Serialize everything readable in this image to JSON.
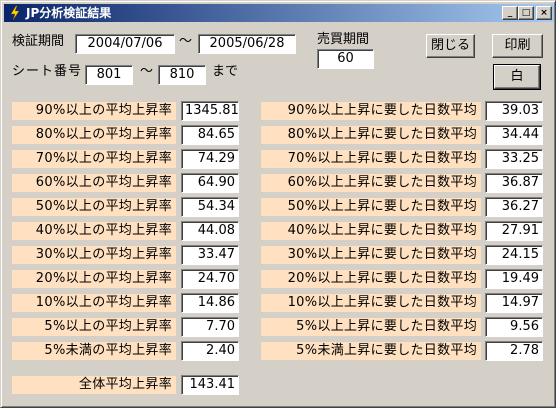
{
  "window": {
    "title": "JP分析検証結果",
    "minimize": "_",
    "maximize": "□",
    "close": "×"
  },
  "header": {
    "period_label": "検証期間",
    "date_from": "2004/07/06",
    "tilde1": "〜",
    "date_to": "2005/06/28",
    "trade_label": "売買期間",
    "trade_value": "60",
    "sheet_label": "シート番号",
    "sheet_from": "801",
    "tilde2": "〜",
    "sheet_to": "810",
    "made": "まで",
    "close_button": "閉じる",
    "print_button": "印刷",
    "white_button": "白"
  },
  "left_rows": [
    {
      "label": "90%以上の平均上昇率",
      "value": "1345.81"
    },
    {
      "label": "80%以上の平均上昇率",
      "value": "84.65"
    },
    {
      "label": "70%以上の平均上昇率",
      "value": "74.29"
    },
    {
      "label": "60%以上の平均上昇率",
      "value": "64.90"
    },
    {
      "label": "50%以上の平均上昇率",
      "value": "54.34"
    },
    {
      "label": "40%以上の平均上昇率",
      "value": "44.08"
    },
    {
      "label": "30%以上の平均上昇率",
      "value": "33.47"
    },
    {
      "label": "20%以上の平均上昇率",
      "value": "24.70"
    },
    {
      "label": "10%以上の平均上昇率",
      "value": "14.86"
    },
    {
      "label": "5%以上の平均上昇率",
      "value": "7.70"
    },
    {
      "label": "5%未満の平均上昇率",
      "value": "2.40"
    }
  ],
  "right_rows": [
    {
      "label": "90%以上上昇に要した日数平均",
      "value": "39.03"
    },
    {
      "label": "80%以上上昇に要した日数平均",
      "value": "34.44"
    },
    {
      "label": "70%以上上昇に要した日数平均",
      "value": "33.25"
    },
    {
      "label": "60%以上上昇に要した日数平均",
      "value": "36.87"
    },
    {
      "label": "50%以上上昇に要した日数平均",
      "value": "36.27"
    },
    {
      "label": "40%以上上昇に要した日数平均",
      "value": "27.91"
    },
    {
      "label": "30%以上上昇に要した日数平均",
      "value": "24.15"
    },
    {
      "label": "20%以上上昇に要した日数平均",
      "value": "19.49"
    },
    {
      "label": "10%以上上昇に要した日数平均",
      "value": "14.97"
    },
    {
      "label": "5%以上上昇に要した日数平均",
      "value": "9.56"
    },
    {
      "label": "5%未満上昇に要した日数平均",
      "value": "2.78"
    }
  ],
  "total": {
    "label": "全体平均上昇率",
    "value": "143.41"
  },
  "colors": {
    "label_bg": "#ffe0c0",
    "titlebar": "#0a246a",
    "window_bg": "#d4d0c8"
  }
}
